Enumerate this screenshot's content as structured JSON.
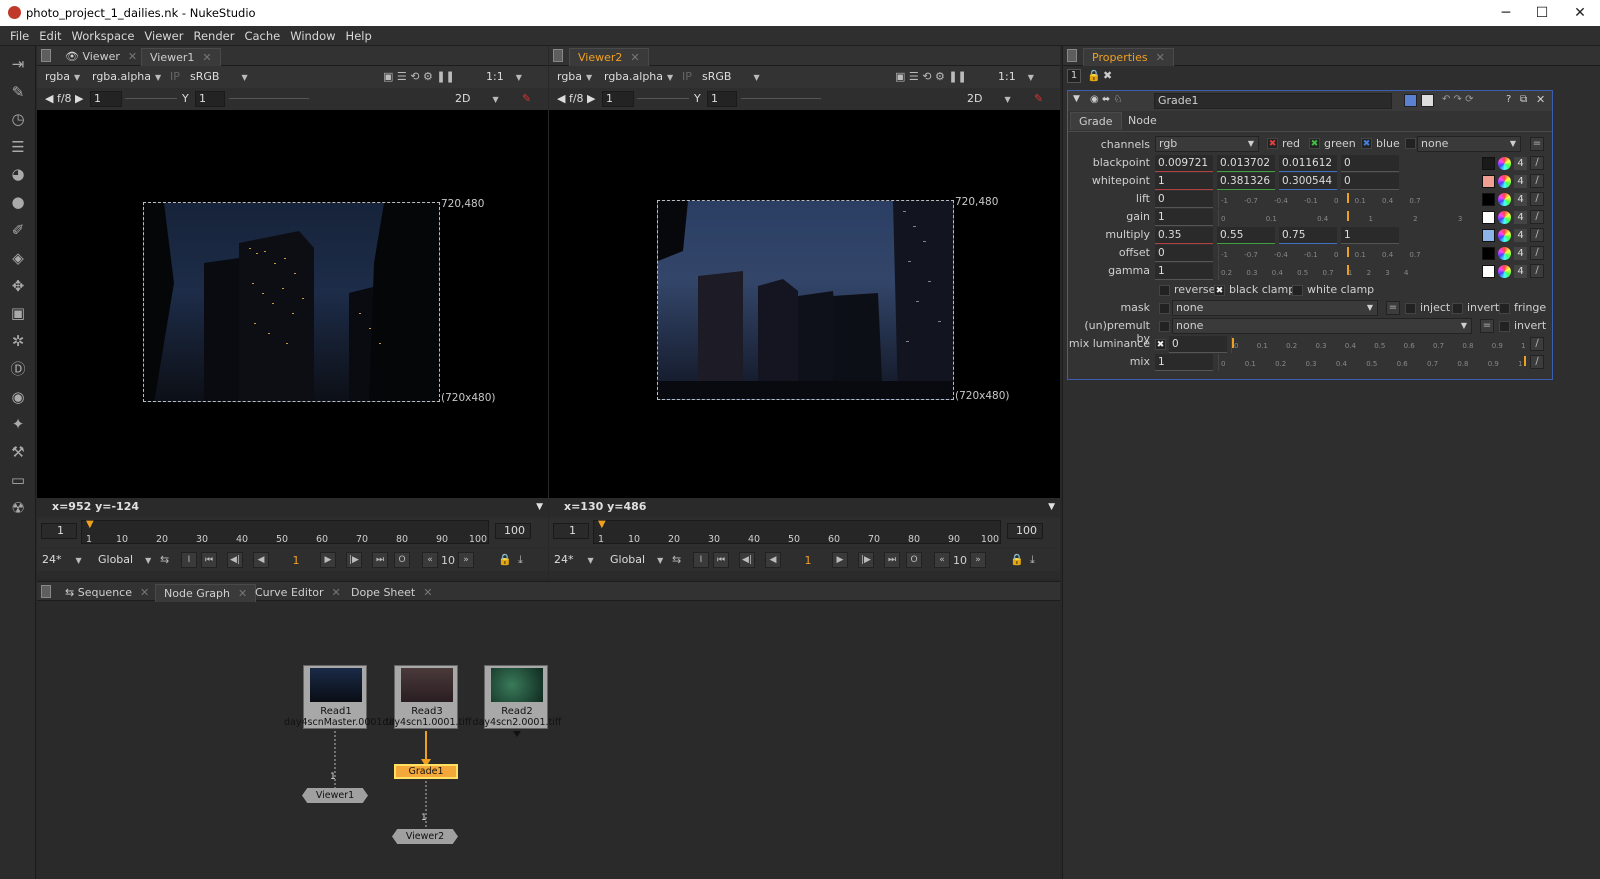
{
  "window": {
    "title": "photo_project_1_dailies.nk - NukeStudio",
    "minimize": "─",
    "maximize": "☐",
    "close": "✕"
  },
  "menu": [
    "File",
    "Edit",
    "Workspace",
    "Viewer",
    "Render",
    "Cache",
    "Window",
    "Help"
  ],
  "tools": [
    "import-icon",
    "paint-icon",
    "time-icon",
    "channel-icon",
    "color-icon",
    "filter-icon",
    "draw-icon",
    "merge-icon",
    "transform-icon",
    "3d-icon",
    "particle-icon",
    "deep-icon",
    "views-icon",
    "metadata-icon",
    "toolsets-icon",
    "other-icon",
    "nuke-icon"
  ],
  "viewer1": {
    "tabs": [
      "Viewer",
      "Viewer1"
    ],
    "channels": "rgba",
    "alpha": "rgba.alpha",
    "ip": "IP",
    "lut": "sRGB",
    "zoom": "1:1",
    "fstop": "f/8",
    "gain": "1",
    "gamma_label": "Y",
    "gamma": "1",
    "mode": "2D",
    "fmt_top": "720,480",
    "fmt_bottom": "(720x480)",
    "cursor": "x=952 y=-124",
    "in": "1",
    "out": "100",
    "fps": "24*",
    "scope": "Global",
    "frame": "1",
    "inc": "10",
    "ticks": [
      "1",
      "10",
      "20",
      "30",
      "40",
      "50",
      "60",
      "70",
      "80",
      "90",
      "100"
    ]
  },
  "viewer2": {
    "tabs": [
      "Viewer2"
    ],
    "channels": "rgba",
    "alpha": "rgba.alpha",
    "ip": "IP",
    "lut": "sRGB",
    "zoom": "1:1",
    "fstop": "f/8",
    "gain": "1",
    "gamma_label": "Y",
    "gamma": "1",
    "mode": "2D",
    "fmt_top": "720,480",
    "fmt_bottom": "(720x480)",
    "cursor": "x=130 y=486",
    "in": "1",
    "out": "100",
    "fps": "24*",
    "scope": "Global",
    "frame": "1",
    "inc": "10",
    "ticks": [
      "1",
      "10",
      "20",
      "30",
      "40",
      "50",
      "60",
      "70",
      "80",
      "90",
      "100"
    ]
  },
  "bottom_tabs": [
    "Sequence",
    "Node Graph",
    "Curve Editor",
    "Dope Sheet"
  ],
  "nodes": {
    "read1": {
      "name": "Read1",
      "file": "day4scnMaster.0001.tiff"
    },
    "read3": {
      "name": "Read3",
      "file": "day4scn1.0001.tiff"
    },
    "read2": {
      "name": "Read2",
      "file": "day4scn2.0001.tiff"
    },
    "grade1": "Grade1",
    "viewer1": "Viewer1",
    "viewer2": "Viewer2",
    "input1": "1",
    "input2": "1"
  },
  "properties": {
    "tab": "Properties",
    "count": "1",
    "node_name": "Grade1",
    "subtabs": [
      "Grade",
      "Node"
    ],
    "channels_label": "channels",
    "channels": "rgb",
    "red": "red",
    "green": "green",
    "blue": "blue",
    "extra": "none",
    "rows": [
      {
        "label": "blackpoint",
        "v": [
          "0.009721",
          "0.013702",
          "0.011612",
          "0"
        ],
        "swatch": "#1a1a1a"
      },
      {
        "label": "whitepoint",
        "v": [
          "1",
          "0.381326",
          "0.300544",
          "0"
        ],
        "swatch": "#f0a090"
      },
      {
        "label": "lift",
        "v": [
          "0"
        ],
        "swatch": "#000000",
        "ticks": [
          "-1",
          "-0.7",
          "-0.4",
          "-0.1",
          "0",
          "0.1",
          "0.4",
          "0.7"
        ]
      },
      {
        "label": "gain",
        "v": [
          "1"
        ],
        "swatch": "#ffffff",
        "ticks": [
          "0",
          "0.1",
          "0.4",
          "1",
          "2",
          "3"
        ]
      },
      {
        "label": "multiply",
        "v": [
          "0.35",
          "0.55",
          "0.75",
          "1"
        ],
        "swatch": "#8cb4e8"
      },
      {
        "label": "offset",
        "v": [
          "0"
        ],
        "swatch": "#000000",
        "ticks": [
          "-1",
          "-0.7",
          "-0.4",
          "-0.1",
          "0",
          "0.1",
          "0.4",
          "0.7"
        ]
      },
      {
        "label": "gamma",
        "v": [
          "1"
        ],
        "swatch": "#ffffff",
        "ticks": [
          "0.2",
          "0.3",
          "0.4",
          "0.5",
          "0.7",
          "1",
          "2",
          "3",
          "4"
        ]
      }
    ],
    "four": "4",
    "reverse": "reverse",
    "black_clamp": "black clamp",
    "white_clamp": "white clamp",
    "mask_label": "mask",
    "mask": "none",
    "inject": "inject",
    "invert": "invert",
    "fringe": "fringe",
    "premult_label": "(un)premult by",
    "premult": "none",
    "invert2": "invert",
    "mixlum_label": "mix luminance",
    "mixlum": "0",
    "mix_label": "mix",
    "mix": "1",
    "mix_ticks": [
      "0",
      "0.1",
      "0.2",
      "0.3",
      "0.4",
      "0.5",
      "0.6",
      "0.7",
      "0.8",
      "0.9",
      "1"
    ]
  }
}
